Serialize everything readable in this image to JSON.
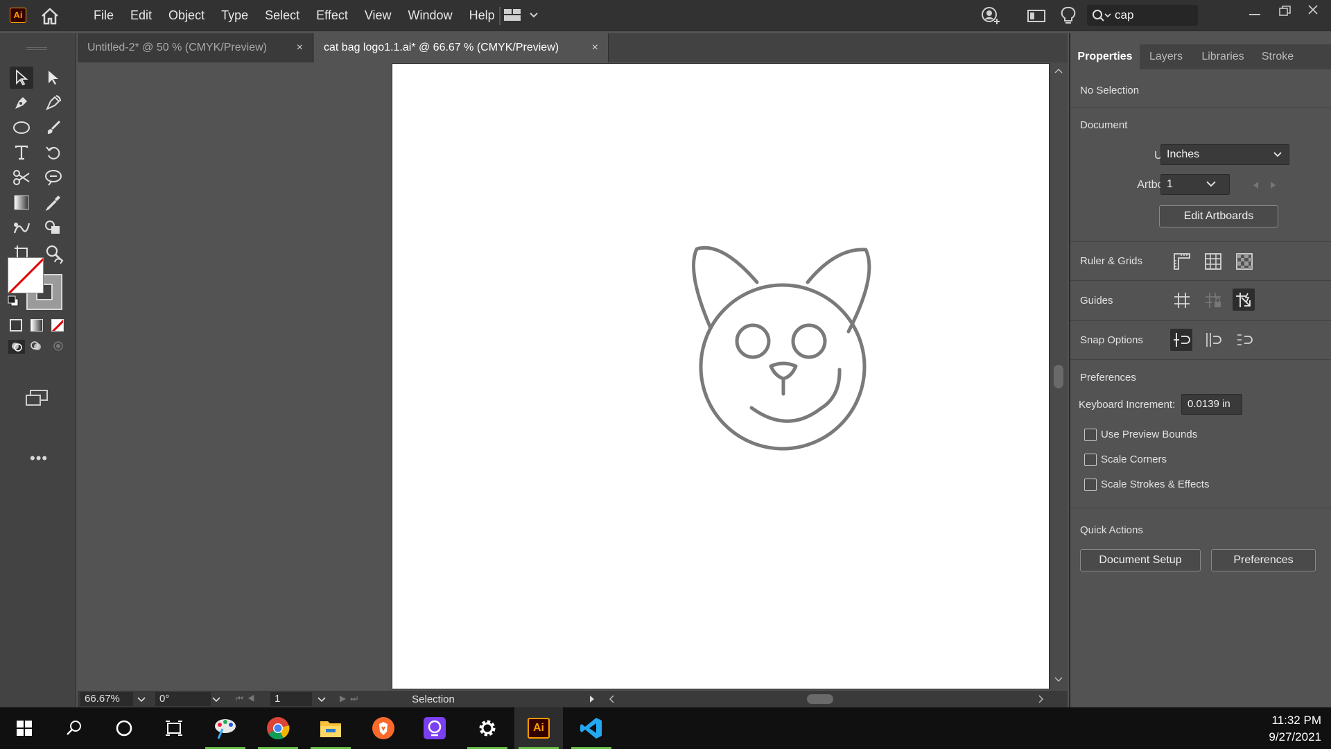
{
  "app": {
    "logo": "Ai"
  },
  "menu": [
    "File",
    "Edit",
    "Object",
    "Type",
    "Select",
    "Effect",
    "View",
    "Window",
    "Help"
  ],
  "search": {
    "value": "cap"
  },
  "doc_tabs": [
    {
      "title": "Untitled-2* @ 50 % (CMYK/Preview)",
      "close": "×"
    },
    {
      "title": "cat bag logo1.1.ai* @ 66.67 % (CMYK/Preview)",
      "close": "×"
    }
  ],
  "status": {
    "zoom": "66.67%",
    "rotation": "0°",
    "artboard": "1",
    "tool": "Selection"
  },
  "panel": {
    "tabs": [
      "Properties",
      "Layers",
      "Libraries",
      "Stroke"
    ],
    "selection": "No Selection",
    "document": {
      "heading": "Document",
      "units_label": "Units:",
      "units_value": "Inches",
      "artboard_label": "Artboard:",
      "artboard_value": "1",
      "edit_artboards": "Edit Artboards"
    },
    "ruler_grids": "Ruler & Grids",
    "guides": "Guides",
    "snap_options": "Snap Options",
    "preferences": {
      "heading": "Preferences",
      "keyboard_increment_label": "Keyboard Increment:",
      "keyboard_increment_value": "0.0139 in",
      "checkboxes": [
        "Use Preview Bounds",
        "Scale Corners",
        "Scale Strokes & Effects"
      ]
    },
    "quick_actions": {
      "heading": "Quick Actions",
      "document_setup": "Document Setup",
      "preferences": "Preferences"
    }
  },
  "taskbar": {
    "time": "11:32 PM",
    "date": "9/27/2021"
  },
  "colors": {
    "accent_ai": "#ff9a00",
    "artwork_stroke": "#7a7a7c"
  }
}
